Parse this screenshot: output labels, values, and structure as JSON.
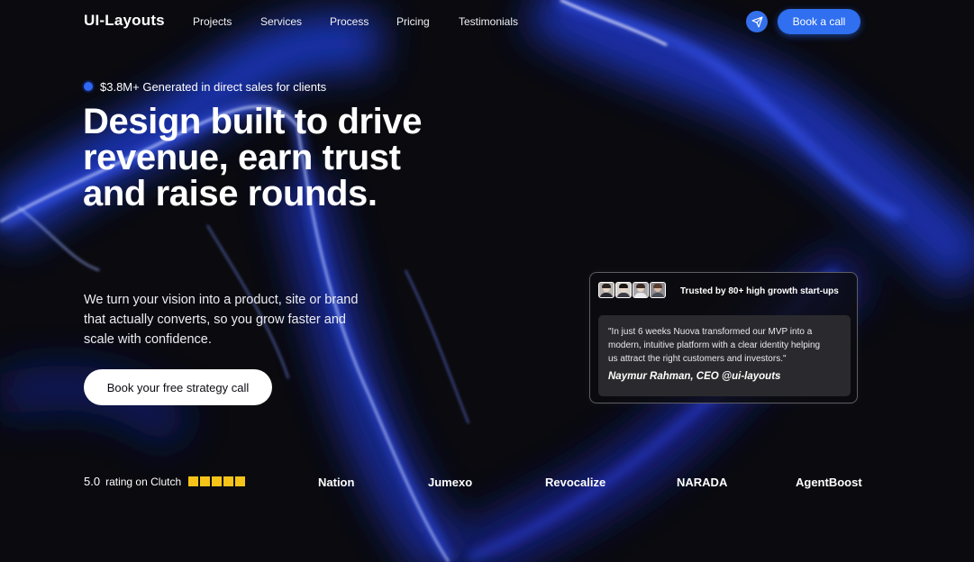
{
  "nav": {
    "logo": "UI-Layouts",
    "links": [
      "Projects",
      "Services",
      "Process",
      "Pricing",
      "Testimonials"
    ],
    "cta_icon": "send-icon",
    "cta_label": "Book a call"
  },
  "hero": {
    "badge": "$3.8M+ Generated in direct sales for clients",
    "headline_lines": [
      "Design built to drive",
      "revenue, earn trust",
      "and raise rounds."
    ],
    "sub_lines": [
      "We turn your vision into a product, site or brand",
      "that actually converts, so you grow faster and",
      "scale with confidence."
    ],
    "cta_label": "Book your free strategy call"
  },
  "testimonial": {
    "title": "Trusted by 80+ high growth start-ups",
    "quote_lines": [
      "\"In just 6 weeks Nuova transformed our MVP into a",
      "modern, intuitive platform with a clear identity helping",
      "us attract the right customers and investors.\""
    ],
    "author": "Naymur Rahman, CEO @ui-layouts"
  },
  "rating": {
    "score": "5.0",
    "text": "rating on Clutch",
    "stars": 5
  },
  "brands": [
    "Nation",
    "Jumexo",
    "Revocalize",
    "NARADA",
    "AgentBoost"
  ],
  "colors": {
    "accent": "#2f6ff0",
    "background": "#0a0a0f",
    "star": "#f6c418"
  }
}
